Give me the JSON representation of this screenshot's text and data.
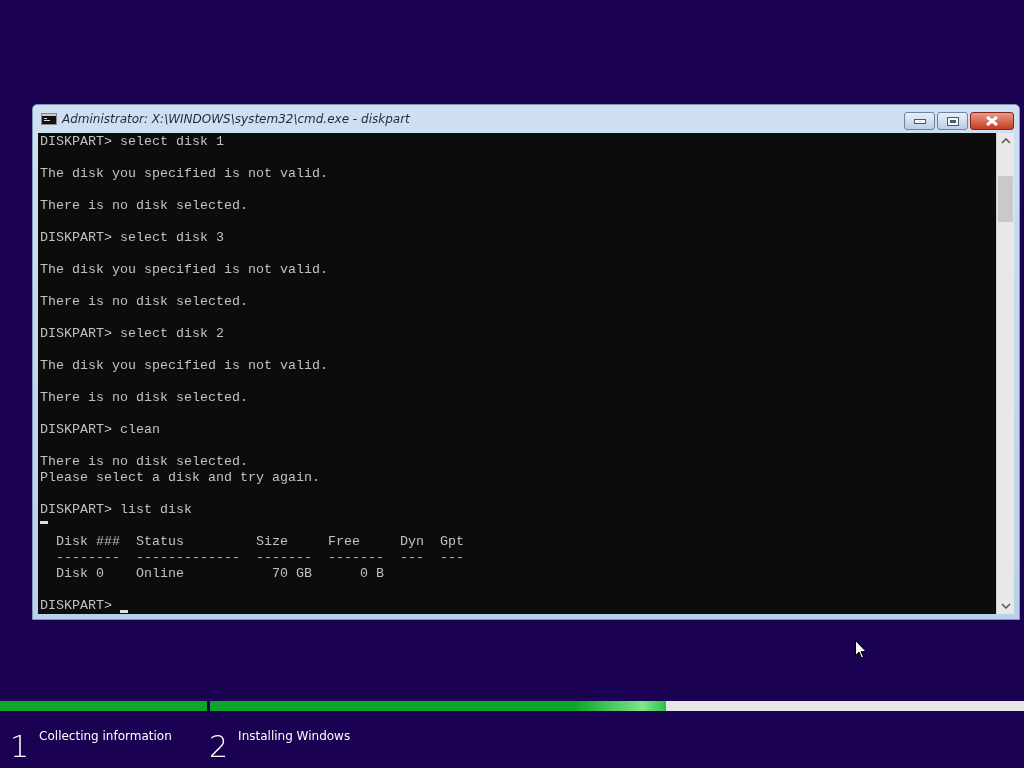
{
  "window": {
    "title": "Administrator: X:\\WINDOWS\\system32\\cmd.exe - diskpart"
  },
  "console": {
    "lines": [
      {
        "kind": "text",
        "text": "DISKPART> select disk 1"
      },
      {
        "kind": "blank"
      },
      {
        "kind": "text",
        "text": "The disk you specified is not valid."
      },
      {
        "kind": "blank"
      },
      {
        "kind": "text",
        "text": "There is no disk selected."
      },
      {
        "kind": "blank"
      },
      {
        "kind": "text",
        "text": "DISKPART> select disk 3"
      },
      {
        "kind": "blank"
      },
      {
        "kind": "text",
        "text": "The disk you specified is not valid."
      },
      {
        "kind": "blank"
      },
      {
        "kind": "text",
        "text": "There is no disk selected."
      },
      {
        "kind": "blank"
      },
      {
        "kind": "text",
        "text": "DISKPART> select disk 2"
      },
      {
        "kind": "blank"
      },
      {
        "kind": "text",
        "text": "The disk you specified is not valid."
      },
      {
        "kind": "blank"
      },
      {
        "kind": "text",
        "text": "There is no disk selected."
      },
      {
        "kind": "blank"
      },
      {
        "kind": "text",
        "text": "DISKPART> clean"
      },
      {
        "kind": "blank"
      },
      {
        "kind": "text",
        "text": "There is no disk selected."
      },
      {
        "kind": "text",
        "text": "Please select a disk and try again."
      },
      {
        "kind": "blank"
      },
      {
        "kind": "text",
        "text": "DISKPART> list disk"
      },
      {
        "kind": "blank",
        "cursor": true
      },
      {
        "kind": "text",
        "text": "  Disk ###  Status         Size     Free     Dyn  Gpt"
      },
      {
        "kind": "text",
        "text": "  --------  -------------  -------  -------  ---  ---"
      },
      {
        "kind": "text",
        "text": "  Disk 0    Online           70 GB      0 B"
      },
      {
        "kind": "blank"
      },
      {
        "kind": "prompt",
        "text": "DISKPART>",
        "cursor": true
      }
    ]
  },
  "progress": [
    {
      "level": 1
    },
    {
      "level": 0.56
    }
  ],
  "steps": [
    {
      "number": "1",
      "label": "Collecting information"
    },
    {
      "number": "2",
      "label": "Installing Windows"
    }
  ]
}
